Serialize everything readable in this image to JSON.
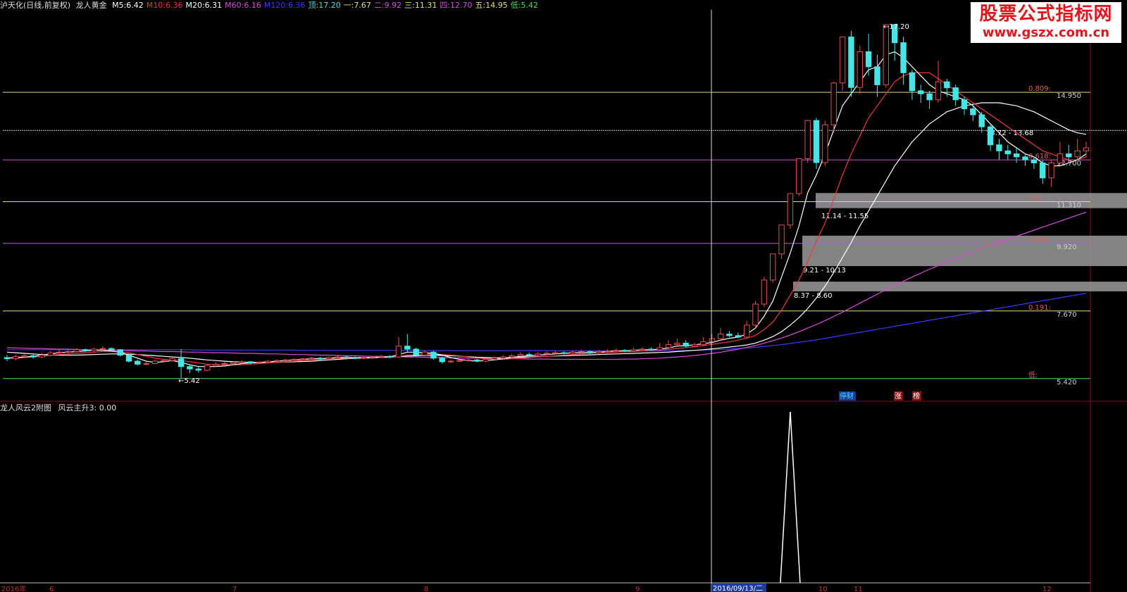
{
  "header": {
    "stock": "泸天化(日线,前复权)",
    "indicator": "龙人黄金",
    "items": [
      {
        "label": "M5:",
        "value": "6.42",
        "color": "#ffffff"
      },
      {
        "label": "M10:",
        "value": "6.36",
        "color": "#e83a3a"
      },
      {
        "label": "M20:",
        "value": "6.31",
        "color": "#ffffff"
      },
      {
        "label": "M60:",
        "value": "6.16",
        "color": "#d94bd9"
      },
      {
        "label": "M120:",
        "value": "6.36",
        "color": "#3a3aff"
      },
      {
        "label": "顶:",
        "value": "17.20",
        "color": "#45e0e0"
      },
      {
        "label": "一:",
        "value": "7.67",
        "color": "#e0e070"
      },
      {
        "label": "二:",
        "value": "9.92",
        "color": "#d94bd9"
      },
      {
        "label": "三:",
        "value": "11.31",
        "color": "#e0e070"
      },
      {
        "label": "四:",
        "value": "12.70",
        "color": "#d94bd9"
      },
      {
        "label": "五:",
        "value": "14.95",
        "color": "#e0e070"
      },
      {
        "label": "低:",
        "value": "5.42",
        "color": "#4ae04a"
      }
    ]
  },
  "sub": {
    "title": "龙人风云2附图",
    "value_label": "风云主升3: 0.00"
  },
  "watermark": {
    "line1": "股票公式指标网",
    "line2": "www.gszx.com.cn"
  },
  "colors": {
    "up": "#e05050",
    "down": "#45e6e6",
    "gold": "#e0e070",
    "magenta": "#d94bd9",
    "green": "#4ae04a"
  },
  "chart_data": {
    "type": "candlestick",
    "ylim": [
      4.9,
      17.6
    ],
    "fib_levels": [
      {
        "ratio": "0.809",
        "price": "14.950",
        "value": 14.95,
        "color": "#e0e070"
      },
      {
        "ratio": "0.618",
        "price": "12.700",
        "value": 12.7,
        "color": "#d94bd9"
      },
      {
        "ratio": "1/2",
        "price": "11.310",
        "value": 11.31,
        "color": "#e0e070"
      },
      {
        "ratio": "0.382",
        "price": "9.920",
        "value": 9.92,
        "color": "#d94bd9"
      },
      {
        "ratio": "0.191",
        "price": "7.670",
        "value": 7.67,
        "color": "#e0e070"
      },
      {
        "ratio": "低",
        "price": "5.420",
        "value": 5.42,
        "color": "#4ae04a"
      }
    ],
    "resistance_line": 13.68,
    "zones": [
      {
        "label": "13.72 - 13.68",
        "low": 13.68,
        "high": 13.72
      },
      {
        "label": "11.14 - 11.55",
        "low": 11.14,
        "high": 11.55
      },
      {
        "label": "9.21 - 10.13",
        "low": 9.21,
        "high": 10.13
      },
      {
        "label": "8.37 - 8.60",
        "low": 8.37,
        "high": 8.6
      }
    ],
    "high_label": "17.20",
    "low_label": "5.42",
    "crosshair_date": "2016/09/13/二",
    "x_labels": [
      "2016年",
      "6",
      "7",
      "8",
      "9",
      "10",
      "11",
      "12"
    ],
    "events": [
      "停财",
      "涨",
      "榜"
    ],
    "candles": [
      [
        6.12,
        6.08,
        6.2,
        6.0
      ],
      [
        6.08,
        6.15,
        6.22,
        6.02
      ],
      [
        6.15,
        6.18,
        6.25,
        6.1
      ],
      [
        6.18,
        6.14,
        6.22,
        6.08
      ],
      [
        6.14,
        6.2,
        6.28,
        6.1
      ],
      [
        6.2,
        6.28,
        6.34,
        6.16
      ],
      [
        6.28,
        6.3,
        6.38,
        6.22
      ],
      [
        6.3,
        6.32,
        6.4,
        6.26
      ],
      [
        6.32,
        6.38,
        6.44,
        6.28
      ],
      [
        6.38,
        6.35,
        6.42,
        6.3
      ],
      [
        6.35,
        6.4,
        6.45,
        6.3
      ],
      [
        6.4,
        6.42,
        6.5,
        6.36
      ],
      [
        6.42,
        6.38,
        6.46,
        6.32
      ],
      [
        6.38,
        6.2,
        6.4,
        6.15
      ],
      [
        6.2,
        6.0,
        6.22,
        5.95
      ],
      [
        6.0,
        5.9,
        6.05,
        5.85
      ],
      [
        5.9,
        5.92,
        5.98,
        5.86
      ],
      [
        5.92,
        6.0,
        6.05,
        5.9
      ],
      [
        6.0,
        6.02,
        6.08,
        5.96
      ],
      [
        6.02,
        6.08,
        6.14,
        5.98
      ],
      [
        6.08,
        5.82,
        6.4,
        5.42
      ],
      [
        5.82,
        5.74,
        5.86,
        5.6
      ],
      [
        5.74,
        5.7,
        5.8,
        5.62
      ],
      [
        5.7,
        5.86,
        5.9,
        5.66
      ],
      [
        5.86,
        5.9,
        5.96,
        5.8
      ],
      [
        5.9,
        5.92,
        5.98,
        5.86
      ],
      [
        5.92,
        5.96,
        6.0,
        5.88
      ],
      [
        5.96,
        5.98,
        6.02,
        5.92
      ],
      [
        5.98,
        5.94,
        6.0,
        5.9
      ],
      [
        5.94,
        5.96,
        6.0,
        5.9
      ],
      [
        5.96,
        6.0,
        6.04,
        5.92
      ],
      [
        6.0,
        6.02,
        6.06,
        5.96
      ],
      [
        6.02,
        6.04,
        6.08,
        5.98
      ],
      [
        6.04,
        6.06,
        6.1,
        6.0
      ],
      [
        6.06,
        6.08,
        6.12,
        6.02
      ],
      [
        6.08,
        6.1,
        6.14,
        6.04
      ],
      [
        6.1,
        6.08,
        6.14,
        6.04
      ],
      [
        6.08,
        6.12,
        6.16,
        6.04
      ],
      [
        6.12,
        6.14,
        6.18,
        6.08
      ],
      [
        6.14,
        6.12,
        6.18,
        6.08
      ],
      [
        6.12,
        6.1,
        6.16,
        6.06
      ],
      [
        6.1,
        6.12,
        6.16,
        6.06
      ],
      [
        6.12,
        6.14,
        6.18,
        6.08
      ],
      [
        6.14,
        6.16,
        6.2,
        6.1
      ],
      [
        6.16,
        6.14,
        6.2,
        6.1
      ],
      [
        6.14,
        6.5,
        6.8,
        6.1
      ],
      [
        6.5,
        6.4,
        6.9,
        6.3
      ],
      [
        6.4,
        6.2,
        6.45,
        6.15
      ],
      [
        6.2,
        6.3,
        6.36,
        6.16
      ],
      [
        6.3,
        6.1,
        6.34,
        6.05
      ],
      [
        6.1,
        5.98,
        6.15,
        5.92
      ],
      [
        5.98,
        6.0,
        6.05,
        5.94
      ],
      [
        6.0,
        6.02,
        6.06,
        5.96
      ],
      [
        6.02,
        6.04,
        6.08,
        5.98
      ],
      [
        6.04,
        6.0,
        6.08,
        5.96
      ],
      [
        6.0,
        6.06,
        6.1,
        5.96
      ],
      [
        6.06,
        6.1,
        6.16,
        6.02
      ],
      [
        6.1,
        6.14,
        6.2,
        6.06
      ],
      [
        6.14,
        6.18,
        6.24,
        6.1
      ],
      [
        6.18,
        6.22,
        6.3,
        6.14
      ],
      [
        6.22,
        6.2,
        6.28,
        6.16
      ],
      [
        6.2,
        6.24,
        6.3,
        6.16
      ],
      [
        6.24,
        6.26,
        6.32,
        6.2
      ],
      [
        6.26,
        6.28,
        6.34,
        6.22
      ],
      [
        6.28,
        6.26,
        6.32,
        6.22
      ],
      [
        6.26,
        6.3,
        6.36,
        6.22
      ],
      [
        6.3,
        6.32,
        6.38,
        6.26
      ],
      [
        6.32,
        6.28,
        6.36,
        6.24
      ],
      [
        6.28,
        6.32,
        6.38,
        6.24
      ],
      [
        6.32,
        6.34,
        6.4,
        6.28
      ],
      [
        6.34,
        6.36,
        6.42,
        6.3
      ],
      [
        6.36,
        6.34,
        6.4,
        6.3
      ],
      [
        6.34,
        6.38,
        6.44,
        6.3
      ],
      [
        6.38,
        6.4,
        6.46,
        6.34
      ],
      [
        6.4,
        6.38,
        6.46,
        6.34
      ],
      [
        6.38,
        6.45,
        6.6,
        6.34
      ],
      [
        6.45,
        6.55,
        6.7,
        6.4
      ],
      [
        6.55,
        6.6,
        6.75,
        6.5
      ],
      [
        6.6,
        6.5,
        6.7,
        6.45
      ],
      [
        6.5,
        6.55,
        6.62,
        6.46
      ],
      [
        6.55,
        6.65,
        6.8,
        6.5
      ],
      [
        6.65,
        6.75,
        6.9,
        6.6
      ],
      [
        6.75,
        6.9,
        7.1,
        6.7
      ],
      [
        6.9,
        6.85,
        7.0,
        6.8
      ],
      [
        6.85,
        6.8,
        6.95,
        6.76
      ],
      [
        6.8,
        7.2,
        7.35,
        6.76
      ],
      [
        7.2,
        7.9,
        8.0,
        7.1
      ],
      [
        7.9,
        8.7,
        8.8,
        7.8
      ],
      [
        8.7,
        9.57,
        9.57,
        8.6
      ],
      [
        9.57,
        10.53,
        10.53,
        9.4
      ],
      [
        10.53,
        11.58,
        11.58,
        10.4
      ],
      [
        11.58,
        12.74,
        12.74,
        11.5
      ],
      [
        12.74,
        14.01,
        14.01,
        12.6
      ],
      [
        14.01,
        12.61,
        14.1,
        12.4
      ],
      [
        12.61,
        13.87,
        14.0,
        12.5
      ],
      [
        13.87,
        15.26,
        15.3,
        13.6
      ],
      [
        15.26,
        16.79,
        16.79,
        15.0
      ],
      [
        16.79,
        15.11,
        17.0,
        14.8
      ],
      [
        15.11,
        16.3,
        16.5,
        14.9
      ],
      [
        16.3,
        15.8,
        16.9,
        15.5
      ],
      [
        15.8,
        15.2,
        16.2,
        14.8
      ],
      [
        15.2,
        17.2,
        17.2,
        15.1
      ],
      [
        17.2,
        16.6,
        17.2,
        16.0
      ],
      [
        16.6,
        15.6,
        16.8,
        15.2
      ],
      [
        15.6,
        15.0,
        15.7,
        14.7
      ],
      [
        15.0,
        14.9,
        15.2,
        14.6
      ],
      [
        14.9,
        14.7,
        15.0,
        14.4
      ],
      [
        14.7,
        15.3,
        16.0,
        14.6
      ],
      [
        15.3,
        15.1,
        15.4,
        14.8
      ],
      [
        15.1,
        14.7,
        15.2,
        14.5
      ],
      [
        14.7,
        14.4,
        14.8,
        14.2
      ],
      [
        14.4,
        14.2,
        14.5,
        14.0
      ],
      [
        14.2,
        13.8,
        14.3,
        13.6
      ],
      [
        13.8,
        13.2,
        13.9,
        13.0
      ],
      [
        13.2,
        13.0,
        13.4,
        12.7
      ],
      [
        13.0,
        12.9,
        13.2,
        12.7
      ],
      [
        12.9,
        12.8,
        13.1,
        12.6
      ],
      [
        12.8,
        12.7,
        12.9,
        12.5
      ],
      [
        12.7,
        12.6,
        12.8,
        12.4
      ],
      [
        12.6,
        12.1,
        12.7,
        11.9
      ],
      [
        12.1,
        12.6,
        12.7,
        11.8
      ],
      [
        12.6,
        12.9,
        13.3,
        12.5
      ],
      [
        12.9,
        12.8,
        13.2,
        12.6
      ],
      [
        12.8,
        13.0,
        13.4,
        12.7
      ],
      [
        13.0,
        13.1,
        13.3,
        12.8
      ]
    ],
    "ma5": [
      6.1,
      6.12,
      6.14,
      6.16,
      6.2,
      6.24,
      6.28,
      6.3,
      6.32,
      6.34,
      6.36,
      6.36,
      6.34,
      6.3,
      6.2,
      6.1,
      6.0,
      5.96,
      5.98,
      6.02,
      5.96,
      5.88,
      5.82,
      5.82,
      5.82,
      5.84,
      5.88,
      5.92,
      5.94,
      5.96,
      5.98,
      6.0,
      6.02,
      6.04,
      6.06,
      6.08,
      6.08,
      6.1,
      6.12,
      6.12,
      6.12,
      6.12,
      6.12,
      6.14,
      6.14,
      6.22,
      6.3,
      6.3,
      6.28,
      6.26,
      6.2,
      6.12,
      6.06,
      6.02,
      6.0,
      6.02,
      6.04,
      6.08,
      6.12,
      6.16,
      6.18,
      6.2,
      6.22,
      6.24,
      6.26,
      6.28,
      6.28,
      6.3,
      6.3,
      6.32,
      6.34,
      6.34,
      6.36,
      6.38,
      6.38,
      6.4,
      6.44,
      6.5,
      6.52,
      6.54,
      6.58,
      6.62,
      6.7,
      6.76,
      6.8,
      6.9,
      7.1,
      7.5,
      8.0,
      8.8,
      9.6,
      10.5,
      11.6,
      12.2,
      12.9,
      13.7,
      14.5,
      14.9,
      15.3,
      15.7,
      15.8,
      16.2,
      16.3,
      16.1,
      15.8,
      15.5,
      15.2,
      15.0,
      14.9,
      14.8,
      14.7,
      14.5,
      14.2,
      13.9,
      13.6,
      13.3,
      13.1,
      12.9,
      12.8,
      12.6,
      12.5,
      12.5,
      12.6,
      12.7,
      12.9
    ],
    "ma10": [
      6.1,
      6.1,
      6.12,
      6.14,
      6.16,
      6.2,
      6.22,
      6.24,
      6.26,
      6.28,
      6.3,
      6.32,
      6.32,
      6.3,
      6.28,
      6.22,
      6.16,
      6.1,
      6.06,
      6.04,
      6.02,
      5.98,
      5.94,
      5.9,
      5.88,
      5.88,
      5.88,
      5.88,
      5.9,
      5.92,
      5.94,
      5.96,
      5.98,
      6.0,
      6.02,
      6.04,
      6.06,
      6.08,
      6.1,
      6.1,
      6.1,
      6.11,
      6.12,
      6.12,
      6.13,
      6.16,
      6.2,
      6.22,
      6.24,
      6.24,
      6.22,
      6.2,
      6.18,
      6.14,
      6.1,
      6.08,
      6.06,
      6.06,
      6.08,
      6.1,
      6.12,
      6.14,
      6.16,
      6.18,
      6.2,
      6.22,
      6.24,
      6.26,
      6.27,
      6.28,
      6.3,
      6.31,
      6.32,
      6.34,
      6.36,
      6.37,
      6.39,
      6.42,
      6.45,
      6.48,
      6.52,
      6.56,
      6.6,
      6.64,
      6.7,
      6.76,
      6.86,
      7.05,
      7.3,
      7.7,
      8.2,
      8.7,
      9.3,
      10.0,
      10.6,
      11.4,
      12.2,
      12.9,
      13.5,
      14.1,
      14.5,
      14.9,
      15.3,
      15.5,
      15.6,
      15.6,
      15.6,
      15.4,
      15.2,
      15.0,
      14.8,
      14.6,
      14.4,
      14.2,
      14.0,
      13.8,
      13.6,
      13.4,
      13.2,
      13.0,
      12.9,
      12.8,
      12.7,
      12.7,
      12.8
    ],
    "ma20": [
      6.3,
      6.28,
      6.26,
      6.24,
      6.22,
      6.2,
      6.2,
      6.2,
      6.2,
      6.21,
      6.22,
      6.23,
      6.24,
      6.24,
      6.23,
      6.22,
      6.2,
      6.18,
      6.16,
      6.14,
      6.12,
      6.1,
      6.07,
      6.04,
      6.02,
      6.0,
      5.98,
      5.97,
      5.96,
      5.96,
      5.96,
      5.96,
      5.97,
      5.98,
      5.99,
      6.0,
      6.02,
      6.04,
      6.06,
      6.08,
      6.09,
      6.1,
      6.11,
      6.12,
      6.13,
      6.15,
      6.17,
      6.18,
      6.19,
      6.19,
      6.19,
      6.18,
      6.17,
      6.15,
      6.13,
      6.12,
      6.11,
      6.11,
      6.12,
      6.13,
      6.14,
      6.15,
      6.16,
      6.17,
      6.18,
      6.19,
      6.2,
      6.21,
      6.22,
      6.23,
      6.24,
      6.25,
      6.26,
      6.27,
      6.28,
      6.29,
      6.3,
      6.32,
      6.34,
      6.36,
      6.38,
      6.41,
      6.44,
      6.47,
      6.5,
      6.54,
      6.6,
      6.7,
      6.82,
      6.98,
      7.2,
      7.45,
      7.75,
      8.1,
      8.5,
      8.95,
      9.45,
      9.95,
      10.5,
      11.0,
      11.5,
      12.0,
      12.5,
      12.9,
      13.3,
      13.6,
      13.9,
      14.1,
      14.3,
      14.4,
      14.5,
      14.55,
      14.6,
      14.6,
      14.6,
      14.55,
      14.5,
      14.4,
      14.3,
      14.15,
      14.0,
      13.85,
      13.7,
      13.6,
      13.55
    ],
    "ma60": [
      6.45,
      6.44,
      6.43,
      6.42,
      6.42,
      6.41,
      6.4,
      6.4,
      6.39,
      6.38,
      6.38,
      6.37,
      6.36,
      6.36,
      6.35,
      6.34,
      6.34,
      6.33,
      6.32,
      6.32,
      6.31,
      6.3,
      6.3,
      6.29,
      6.28,
      6.28,
      6.27,
      6.26,
      6.26,
      6.25,
      6.24,
      6.24,
      6.23,
      6.22,
      6.22,
      6.21,
      6.2,
      6.2,
      6.19,
      6.18,
      6.18,
      6.17,
      6.16,
      6.16,
      6.15,
      6.15,
      6.14,
      6.14,
      6.13,
      6.12,
      6.12,
      6.11,
      6.11,
      6.1,
      6.1,
      6.09,
      6.09,
      6.08,
      6.08,
      6.08,
      6.07,
      6.07,
      6.07,
      6.06,
      6.06,
      6.06,
      6.06,
      6.06,
      6.06,
      6.06,
      6.06,
      6.07,
      6.07,
      6.08,
      6.09,
      6.1,
      6.12,
      6.14,
      6.16,
      6.19,
      6.22,
      6.26,
      6.3,
      6.35,
      6.4,
      6.46,
      6.52,
      6.6,
      6.68,
      6.77,
      6.87,
      6.98,
      7.1,
      7.22,
      7.35,
      7.49,
      7.63,
      7.78,
      7.93,
      8.08,
      8.23,
      8.38,
      8.52,
      8.66,
      8.8,
      8.93,
      9.06,
      9.18,
      9.3,
      9.42,
      9.53,
      9.64,
      9.75,
      9.86,
      9.96,
      10.06,
      10.16,
      10.26,
      10.36,
      10.46,
      10.56,
      10.66,
      10.76,
      10.86,
      10.96
    ],
    "ma120": [
      6.38,
      6.38,
      6.38,
      6.38,
      6.38,
      6.38,
      6.38,
      6.38,
      6.38,
      6.38,
      6.38,
      6.38,
      6.38,
      6.38,
      6.38,
      6.38,
      6.38,
      6.38,
      6.38,
      6.38,
      6.38,
      6.38,
      6.37,
      6.37,
      6.37,
      6.37,
      6.37,
      6.37,
      6.37,
      6.37,
      6.37,
      6.37,
      6.37,
      6.37,
      6.36,
      6.36,
      6.36,
      6.36,
      6.36,
      6.36,
      6.36,
      6.36,
      6.36,
      6.36,
      6.36,
      6.36,
      6.36,
      6.36,
      6.35,
      6.35,
      6.35,
      6.35,
      6.35,
      6.35,
      6.35,
      6.35,
      6.35,
      6.35,
      6.35,
      6.35,
      6.35,
      6.35,
      6.35,
      6.34,
      6.34,
      6.34,
      6.34,
      6.34,
      6.34,
      6.34,
      6.34,
      6.34,
      6.34,
      6.34,
      6.34,
      6.34,
      6.34,
      6.34,
      6.35,
      6.36,
      6.37,
      6.38,
      6.39,
      6.4,
      6.42,
      6.44,
      6.46,
      6.49,
      6.52,
      6.55,
      6.59,
      6.63,
      6.67,
      6.71,
      6.76,
      6.81,
      6.86,
      6.91,
      6.96,
      7.01,
      7.06,
      7.11,
      7.16,
      7.21,
      7.26,
      7.31,
      7.36,
      7.41,
      7.46,
      7.51,
      7.56,
      7.61,
      7.66,
      7.71,
      7.76,
      7.81,
      7.86,
      7.91,
      7.96,
      8.01,
      8.06,
      8.11,
      8.16,
      8.21,
      8.26
    ],
    "sub_signal": [
      {
        "x_index": 90,
        "value": 1
      }
    ]
  }
}
